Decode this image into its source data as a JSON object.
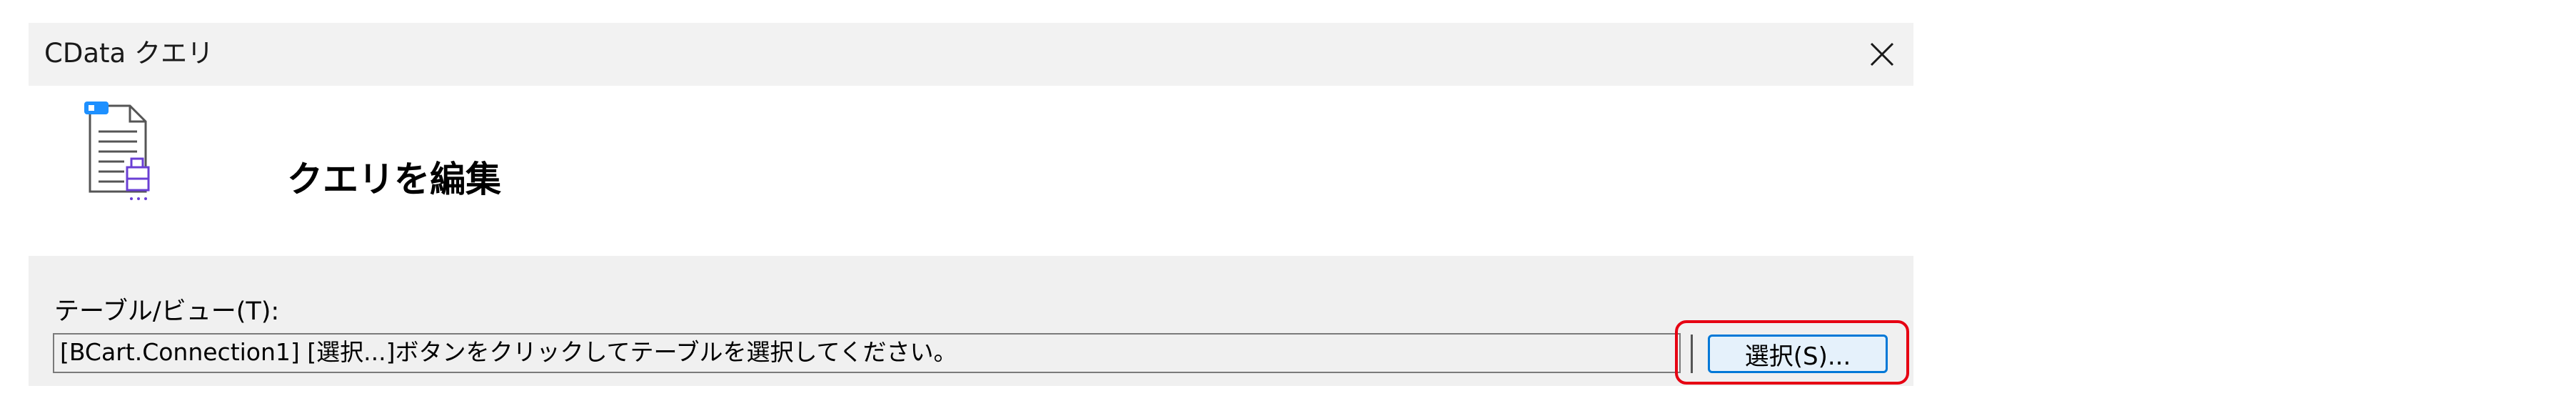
{
  "window": {
    "title": "CData クエリ"
  },
  "header": {
    "title": "クエリを編集",
    "icon": "query-document-icon"
  },
  "form": {
    "table_label": "テーブル/ビュー(T):",
    "table_value": "[BCart.Connection1] [選択...]ボタンをクリックしてテーブルを選択してください。",
    "select_button_label": "選択(S)..."
  },
  "colors": {
    "accent": "#0078d7",
    "highlight": "#e60012",
    "icon_blue": "#1e90ff",
    "icon_purple": "#6a3fd4"
  },
  "icons": {
    "close": "close-icon"
  }
}
